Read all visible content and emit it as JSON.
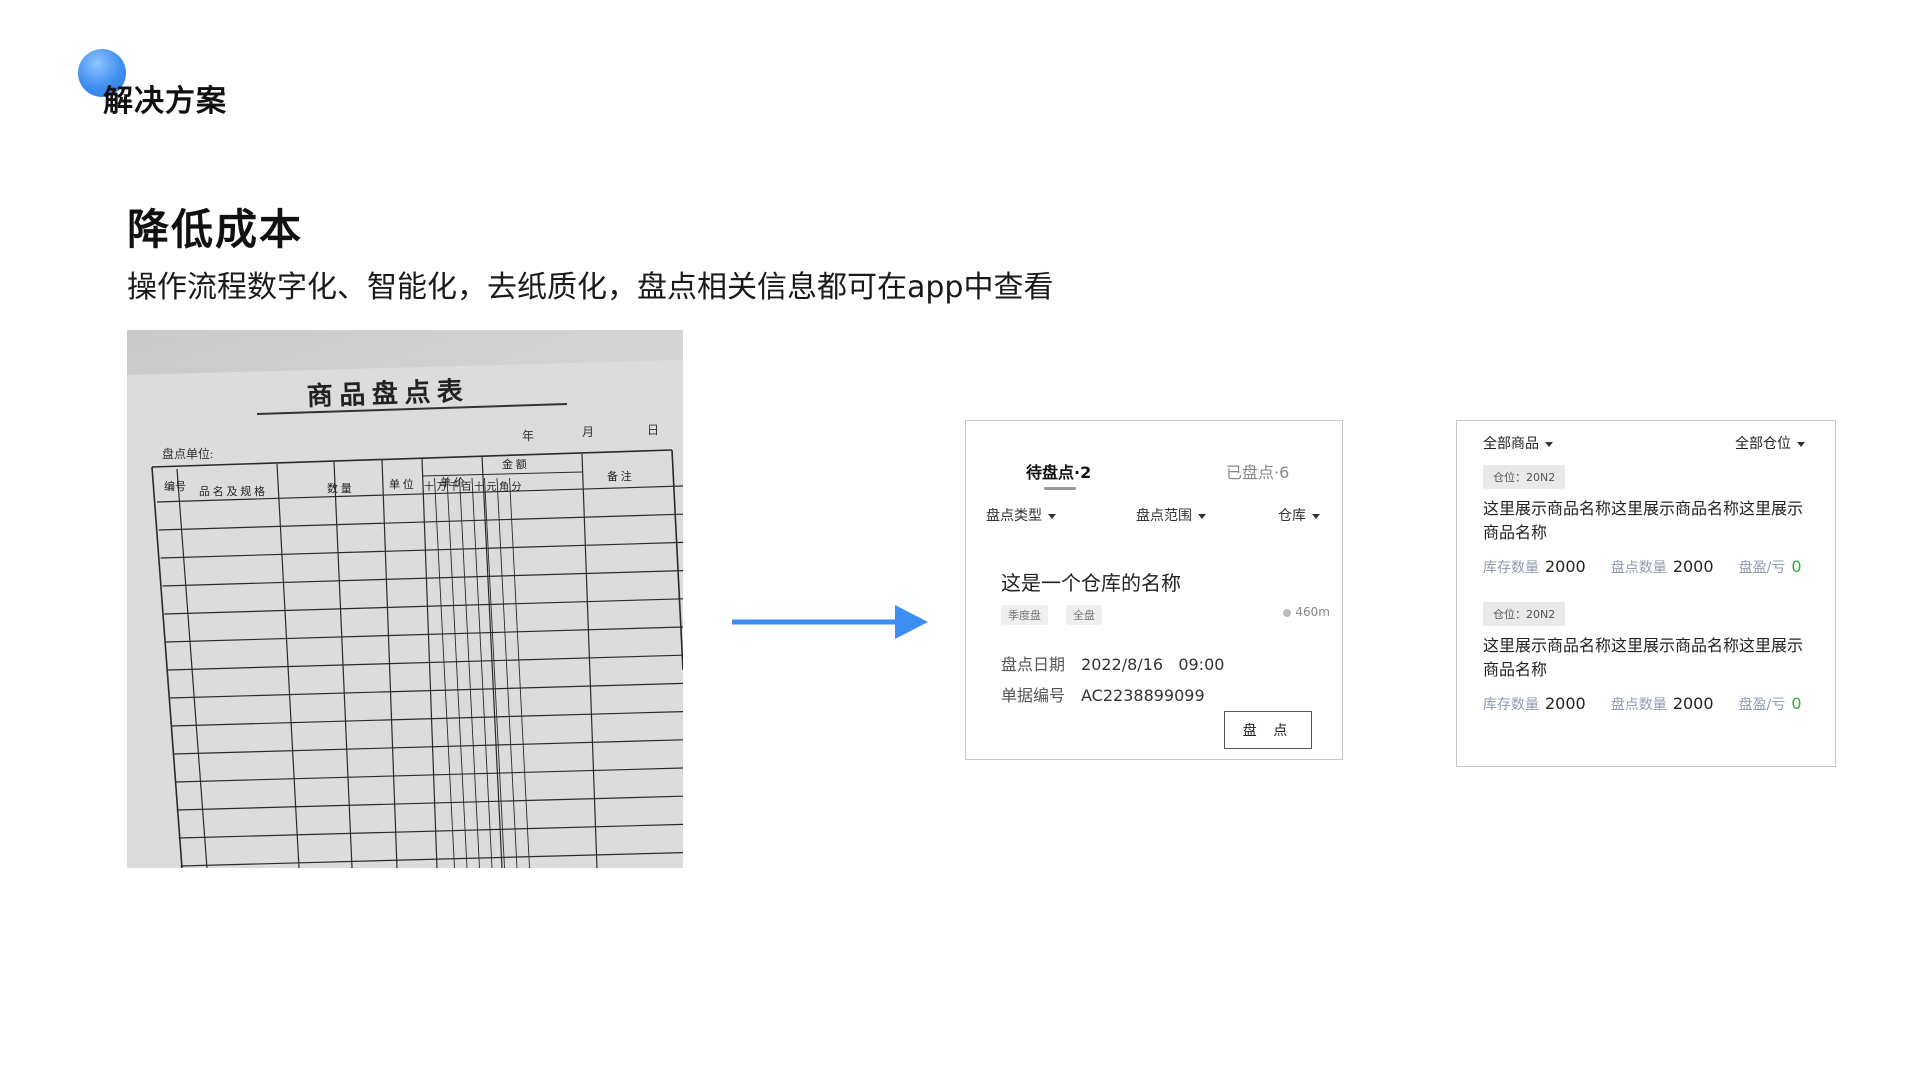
{
  "header": {
    "section_title": "解决方案",
    "heading": "降低成本",
    "subheading": "操作流程数字化、智能化，去纸质化，盘点相关信息都可在app中查看"
  },
  "paper_form": {
    "title": "商 品 盘 点 表",
    "unit_label": "盘点单位:",
    "date_labels": [
      "年",
      "月",
      "日"
    ],
    "columns": [
      "编号",
      "品 名 及 规 格",
      "数 量",
      "单 位",
      "单 价",
      "金 额",
      "备 注"
    ],
    "amount_subcolumns": [
      "十",
      "万",
      "千",
      "百",
      "十",
      "元",
      "角",
      "分"
    ]
  },
  "task_card": {
    "tabs": [
      {
        "label": "待盘点·2",
        "active": true
      },
      {
        "label": "已盘点·6",
        "active": false
      }
    ],
    "filters": [
      "盘点类型",
      "盘点范围",
      "仓库"
    ],
    "warehouse_name": "这是一个仓库的名称",
    "tags": [
      "季度盘",
      "全盘"
    ],
    "distance": "460m",
    "date_label": "盘点日期",
    "date_value": "2022/8/16   09:00",
    "doc_label": "单据编号",
    "doc_value": "AC2238899099",
    "button_label": "盘 点"
  },
  "items_card": {
    "filter_left": "全部商品",
    "filter_right": "全部仓位",
    "items": [
      {
        "location": "仓位：20N2",
        "name": "这里展示商品名称这里展示商品名称这里展示商品名称",
        "stock_label": "库存数量",
        "stock_value": "2000",
        "count_label": "盘点数量",
        "count_value": "2000",
        "diff_label": "盘盈/亏",
        "diff_value": "0"
      },
      {
        "location": "仓位：20N2",
        "name": "这里展示商品名称这里展示商品名称这里展示商品名称",
        "stock_label": "库存数量",
        "stock_value": "2000",
        "count_label": "盘点数量",
        "count_value": "2000",
        "diff_label": "盘盈/亏",
        "diff_value": "0"
      }
    ]
  },
  "colors": {
    "accent_blue": "#3d8ef0",
    "positive_green": "#2eae3c",
    "label_gray_blue": "#8f9bb0"
  }
}
